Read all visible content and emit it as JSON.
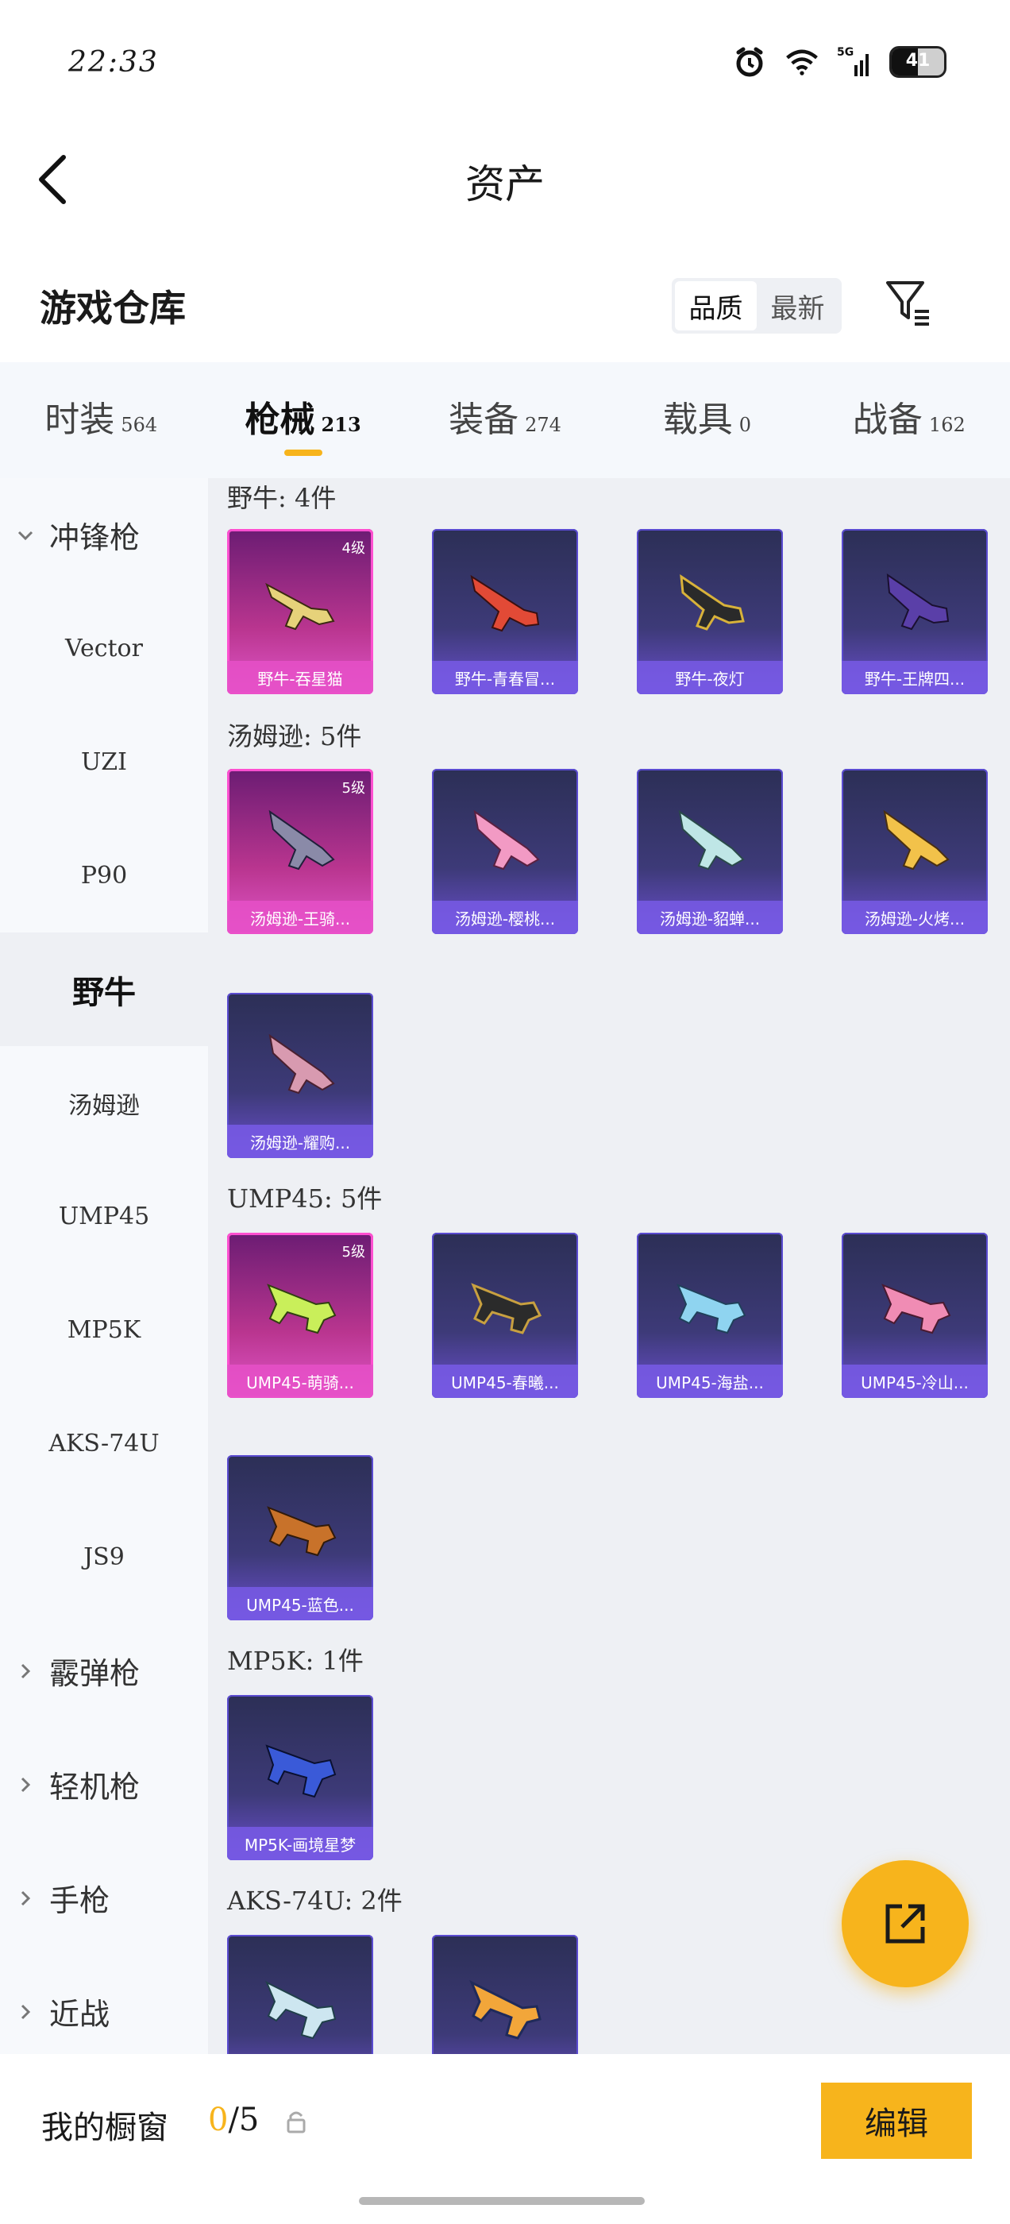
{
  "status": {
    "time": "22:33",
    "battery": "41",
    "network": "5G"
  },
  "header": {
    "title": "资产"
  },
  "section": {
    "title": "游戏仓库",
    "sort_options": [
      "品质",
      "最新"
    ]
  },
  "tabs": [
    {
      "label": "时装",
      "count": "564"
    },
    {
      "label": "枪械",
      "count": "213"
    },
    {
      "label": "装备",
      "count": "274"
    },
    {
      "label": "载具",
      "count": "0"
    },
    {
      "label": "战备",
      "count": "162"
    }
  ],
  "sidebar": [
    {
      "label": "冲锋枪"
    },
    {
      "label": "Vector"
    },
    {
      "label": "UZI"
    },
    {
      "label": "P90"
    },
    {
      "label": "野牛"
    },
    {
      "label": "汤姆逊"
    },
    {
      "label": "UMP45"
    },
    {
      "label": "MP5K"
    },
    {
      "label": "AKS-74U"
    },
    {
      "label": "JS9"
    },
    {
      "label": "霰弹枪"
    },
    {
      "label": "轻机枪"
    },
    {
      "label": "手枪"
    },
    {
      "label": "近战"
    }
  ],
  "groups": [
    {
      "label": "野牛: 4件",
      "items": [
        {
          "name": "野牛-吞星猫",
          "level": "4级"
        },
        {
          "name": "野牛-青春冒...",
          "level": ""
        },
        {
          "name": "野牛-夜灯",
          "level": ""
        },
        {
          "name": "野牛-王牌四...",
          "level": ""
        }
      ]
    },
    {
      "label": "汤姆逊: 5件",
      "items": [
        {
          "name": "汤姆逊-王骑...",
          "level": "5级"
        },
        {
          "name": "汤姆逊-樱桃...",
          "level": ""
        },
        {
          "name": "汤姆逊-貂蝉...",
          "level": ""
        },
        {
          "name": "汤姆逊-火烤...",
          "level": ""
        },
        {
          "name": "汤姆逊-耀购...",
          "level": ""
        }
      ]
    },
    {
      "label": "UMP45: 5件",
      "items": [
        {
          "name": "UMP45-萌骑...",
          "level": "5级"
        },
        {
          "name": "UMP45-春曦...",
          "level": ""
        },
        {
          "name": "UMP45-海盐...",
          "level": ""
        },
        {
          "name": "UMP45-冷山...",
          "level": ""
        },
        {
          "name": "UMP45-蓝色...",
          "level": ""
        }
      ]
    },
    {
      "label": "MP5K: 1件",
      "items": [
        {
          "name": "MP5K-画境星梦",
          "level": ""
        }
      ]
    },
    {
      "label": "AKS-74U: 2件",
      "items": [
        {
          "name": "",
          "level": ""
        },
        {
          "name": "",
          "level": ""
        }
      ]
    }
  ],
  "showcase": {
    "label": "我的橱窗",
    "current": "0",
    "total": "/5"
  },
  "edit_button": "编辑",
  "colors": {
    "accent": "#f7b41c",
    "card_purple": "#3d3a78",
    "card_gold": "#e056c8"
  }
}
